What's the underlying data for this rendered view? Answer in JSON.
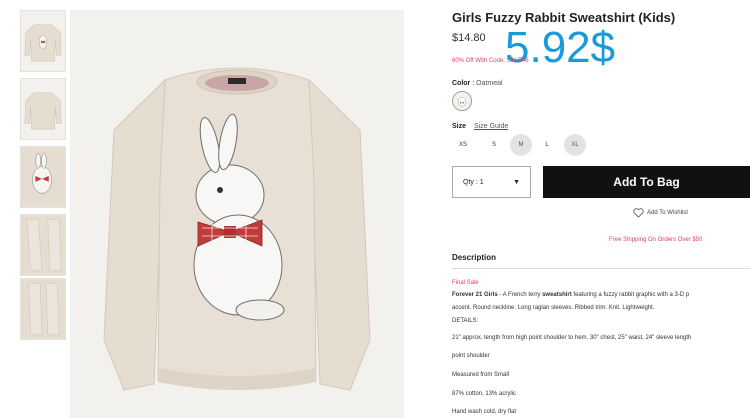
{
  "product": {
    "title": "Girls Fuzzy Rabbit Sweatshirt (Kids)",
    "price": "$14.80",
    "overlay_price": "5.92$",
    "promo": "60% Off With Code: SALE46"
  },
  "color": {
    "label": "Color",
    "separator": " : ",
    "value": "Oatmeal"
  },
  "size": {
    "label": "Size",
    "guide": "Size Guide",
    "options": [
      "XS",
      "S",
      "M",
      "L",
      "XL"
    ]
  },
  "cart": {
    "qty_label": "Qty : 1",
    "qty_caret": "▼",
    "add_label": "Add To Bag",
    "wishlist_label": "Add To Wishlist",
    "shipping_note": "Free Shipping On Orders Over $50"
  },
  "description": {
    "heading": "Description",
    "final_sale": "Final Sale",
    "line1_brand": "Forever 21 Girls",
    "line1_a": " - A French terry ",
    "line1_bold": "sweatshirt",
    "line1_b": " featuring a fuzzy rabbit graphic with a 3-D p",
    "line2": "accent. Round neckline. Long raglan sleeves. Ribbed trim. Knit. Lightweight.",
    "line3": "DETAILS:",
    "line4": "21\" approx. length from high point shoulder to hem, 30\" chest, 25\" waist, 24\" sleeve length",
    "line5": "point shoulder",
    "line6": "Measured from Small",
    "line7": "87% cotton, 13% acrylic",
    "line8": "Hand wash cold, dry flat"
  },
  "colors": {
    "accent_blue": "#1a9bd7",
    "promo_pink": "#e0406a",
    "button_black": "#111111",
    "sweater_oatmeal": "#e6ddd1",
    "bow_red": "#c23b3b"
  },
  "icons": {
    "heart": "heart-outline-icon",
    "caret": "caret-down-icon"
  }
}
